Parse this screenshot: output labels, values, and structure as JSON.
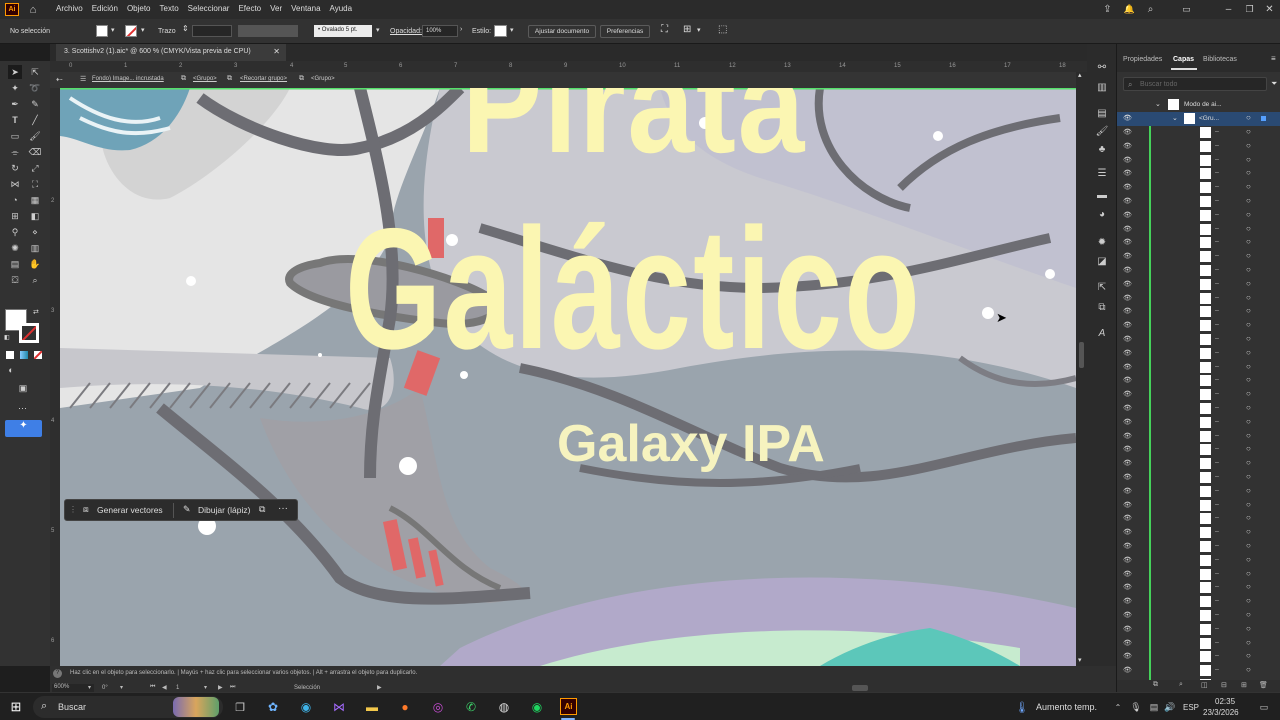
{
  "app": {
    "logo": "Ai"
  },
  "menu": [
    "Archivo",
    "Edición",
    "Objeto",
    "Texto",
    "Seleccionar",
    "Efecto",
    "Ver",
    "Ventana",
    "Ayuda"
  ],
  "controlbar": {
    "selection": "No selección",
    "stroke_label": "Trazo",
    "brush": "Ovalado 5 pt.",
    "opacity_label": "Opacidad:",
    "opacity_value": "100%",
    "style_label": "Estilo:",
    "fit_doc_button": "Ajustar documento",
    "prefs_button": "Preferencias"
  },
  "document_tab": {
    "title": "3. Scottishv2 (1).aic* @ 600 % (CMYK/Vista previa de CPU)"
  },
  "ruler_top": [
    "0",
    "1",
    "2",
    "3",
    "4",
    "5",
    "6",
    "7",
    "8",
    "9",
    "10",
    "11",
    "12",
    "13",
    "14",
    "15",
    "16",
    "17",
    "18"
  ],
  "ruler_left": [
    "2",
    "3",
    "4",
    "5",
    "6"
  ],
  "breadcrumb": [
    "Fondo) Image... incrustada",
    "<Grupo>",
    "<Recortar grupo>",
    "<Grupo>"
  ],
  "artwork": {
    "title_line1": "Pirata",
    "title_line2": "Galáctico",
    "subtitle": "Galaxy IPA",
    "title_color": "#fbf6b2",
    "subtitle_color": "#f6f3bf"
  },
  "context_bar": {
    "generate": "Generar vectores",
    "draw": "Dibujar (lápiz)"
  },
  "panel": {
    "tabs": [
      "Propiedades",
      "Capas",
      "Bibliotecas"
    ],
    "active_tab": "Capas",
    "search_placeholder": "Buscar todo",
    "layer_root": "Modo de ai...",
    "layer_group": "<Gru..."
  },
  "status": {
    "hint": "Haz clic en el objeto para seleccionarlo. | Mayús + haz clic para seleccionar varios objetos. | Alt + arrastra el objeto para duplicarlo.",
    "zoom": "600%",
    "rotation": "0°",
    "artboard": "1",
    "tool": "Selección"
  },
  "taskbar": {
    "search": "Buscar",
    "weather": "Aumento temp.",
    "lang": "ESP",
    "time": "02:35",
    "date": "23/3/2026"
  }
}
